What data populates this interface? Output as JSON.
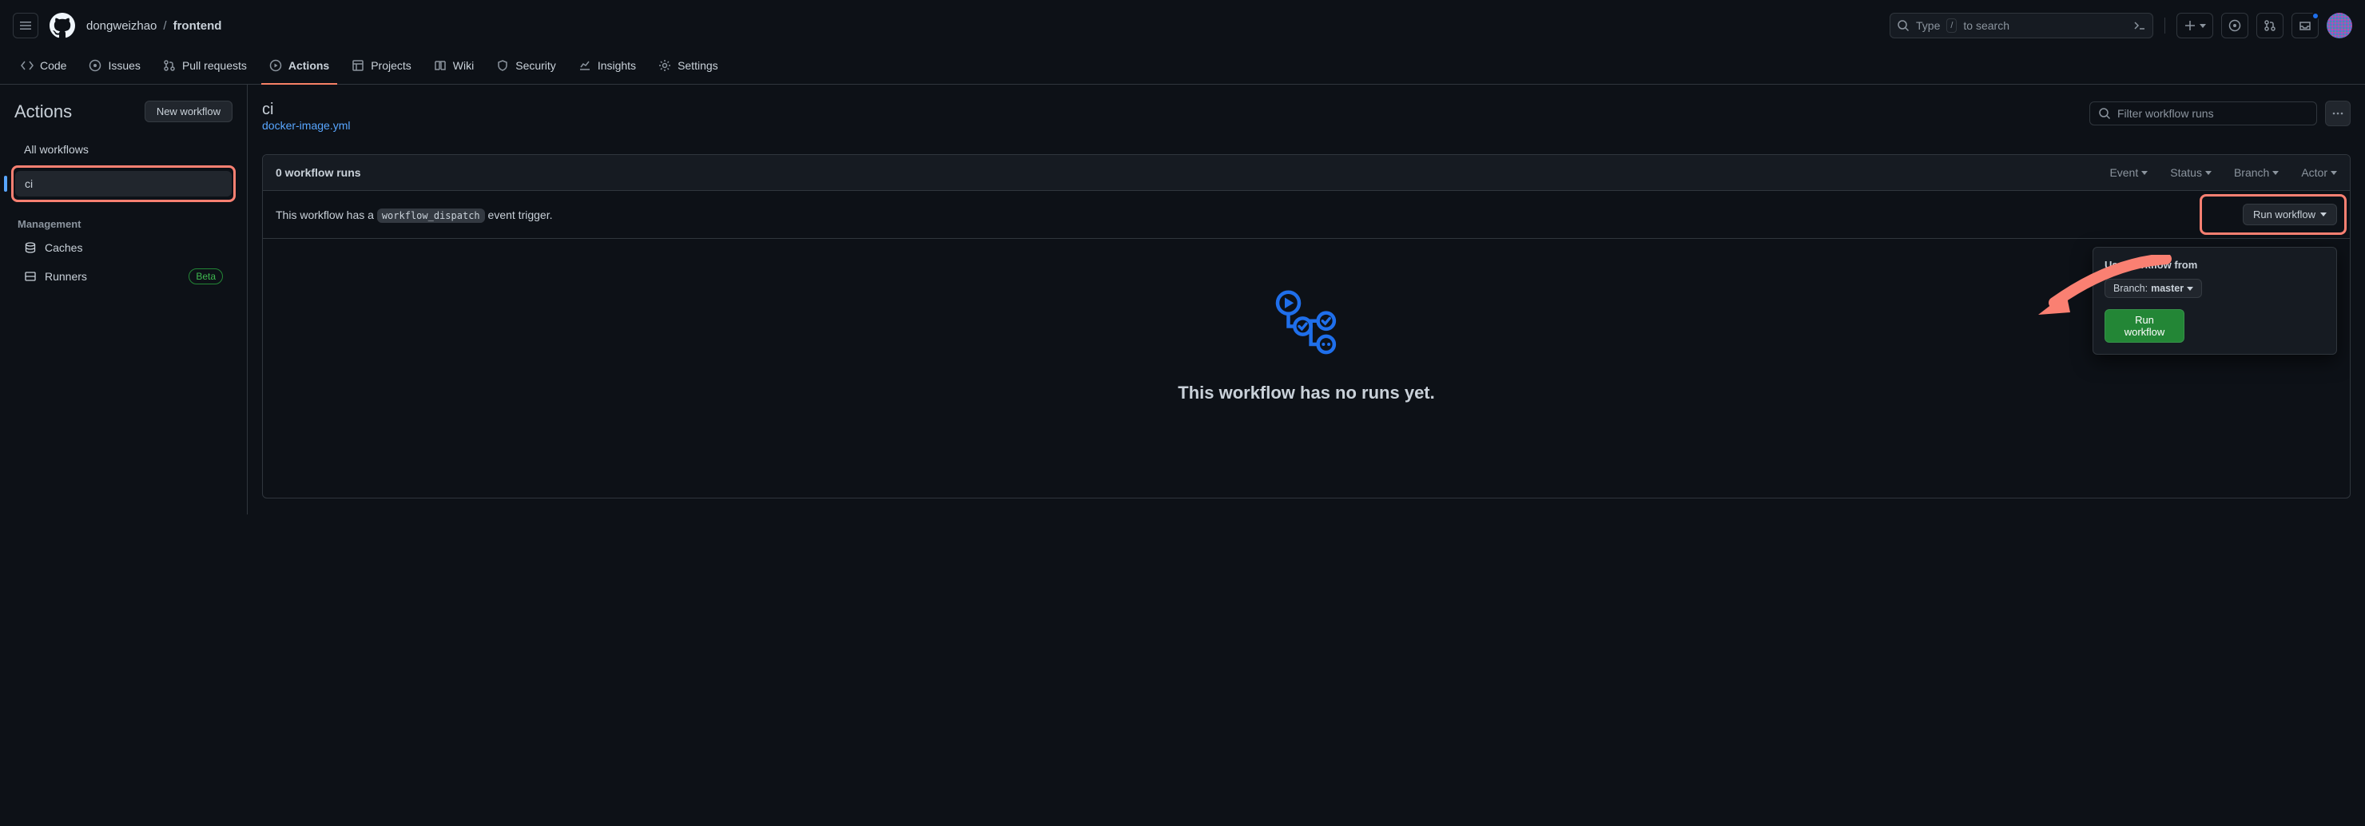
{
  "header": {
    "owner": "dongweizhao",
    "repo": "frontend",
    "search_placeholder": "Type",
    "search_key": "/",
    "search_rest": "to search"
  },
  "repo_nav": {
    "tabs": [
      {
        "label": "Code"
      },
      {
        "label": "Issues"
      },
      {
        "label": "Pull requests"
      },
      {
        "label": "Actions"
      },
      {
        "label": "Projects"
      },
      {
        "label": "Wiki"
      },
      {
        "label": "Security"
      },
      {
        "label": "Insights"
      },
      {
        "label": "Settings"
      }
    ]
  },
  "sidebar": {
    "title": "Actions",
    "new_workflow": "New workflow",
    "all_workflows": "All workflows",
    "workflows": [
      {
        "label": "ci"
      }
    ],
    "management_title": "Management",
    "caches": "Caches",
    "runners": "Runners",
    "beta": "Beta"
  },
  "workflow": {
    "title": "ci",
    "file": "docker-image.yml",
    "filter_placeholder": "Filter workflow runs",
    "runs_count": "0 workflow runs",
    "filters": {
      "event": "Event",
      "status": "Status",
      "branch": "Branch",
      "actor": "Actor"
    },
    "dispatch_prefix": "This workflow has a ",
    "dispatch_code": "workflow_dispatch",
    "dispatch_suffix": " event trigger.",
    "run_workflow_btn": "Run workflow",
    "empty_title": "This workflow has no runs yet."
  },
  "popover": {
    "title": "Use workflow from",
    "branch_label": "Branch: ",
    "branch_value": "master",
    "run_btn": "Run workflow"
  }
}
